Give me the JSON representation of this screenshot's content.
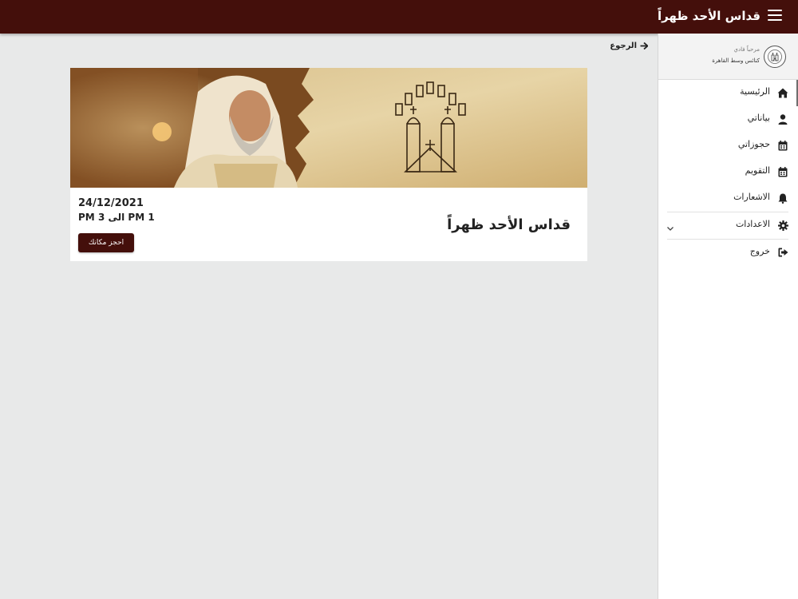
{
  "header": {
    "title": "قداس الأحد ظهراً",
    "menu_icon": "hamburger-menu-icon"
  },
  "sidebar": {
    "greeting": "مرحباً فادي",
    "church": "كنائس وسط القاهرة",
    "items": [
      {
        "label": "الرئيسية",
        "icon": "home-icon"
      },
      {
        "label": "بياناتي",
        "icon": "user-icon"
      },
      {
        "label": "حجوزاتي",
        "icon": "calendar-icon"
      },
      {
        "label": "التقويم",
        "icon": "calendar-icon"
      },
      {
        "label": "الاشعارات",
        "icon": "bell-icon"
      },
      {
        "label": "الاعدادات",
        "icon": "gear-icon"
      },
      {
        "label": "خروج",
        "icon": "logout-icon"
      }
    ]
  },
  "main": {
    "back_label": "الرجوع",
    "event": {
      "title": "قداس الأحد ظهراً",
      "date": "24/12/2021",
      "time": "1 PM الى 3 PM",
      "book_label": "احجز مكانك"
    }
  },
  "colors": {
    "primary": "#440f0b",
    "background": "#e8e9e9"
  }
}
